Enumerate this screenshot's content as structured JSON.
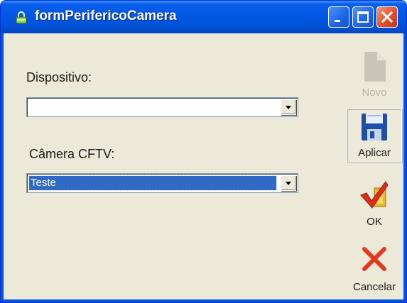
{
  "window": {
    "title": "formPerifericoCamera"
  },
  "fields": {
    "dispositivo": {
      "label": "Dispositivo:",
      "value": ""
    },
    "camera": {
      "label": "Câmera CFTV:",
      "value": "Teste"
    }
  },
  "toolbar": {
    "novo": {
      "label": "Novo",
      "enabled": false
    },
    "aplicar": {
      "label": "Aplicar"
    },
    "ok": {
      "label": "OK"
    },
    "cancelar": {
      "label": "Cancelar"
    }
  },
  "colors": {
    "titlebar": "#0058e6",
    "window_bg": "#ece9d8",
    "selection": "#316ac5",
    "close_button": "#e0502c",
    "cancel_x": "#e23a1e",
    "ok_check": "#d9301a"
  },
  "icons": [
    "lock-icon",
    "minimize-icon",
    "maximize-icon",
    "close-icon",
    "new-document-icon",
    "save-disk-icon",
    "ok-check-icon",
    "cancel-x-icon",
    "chevron-down-icon"
  ]
}
